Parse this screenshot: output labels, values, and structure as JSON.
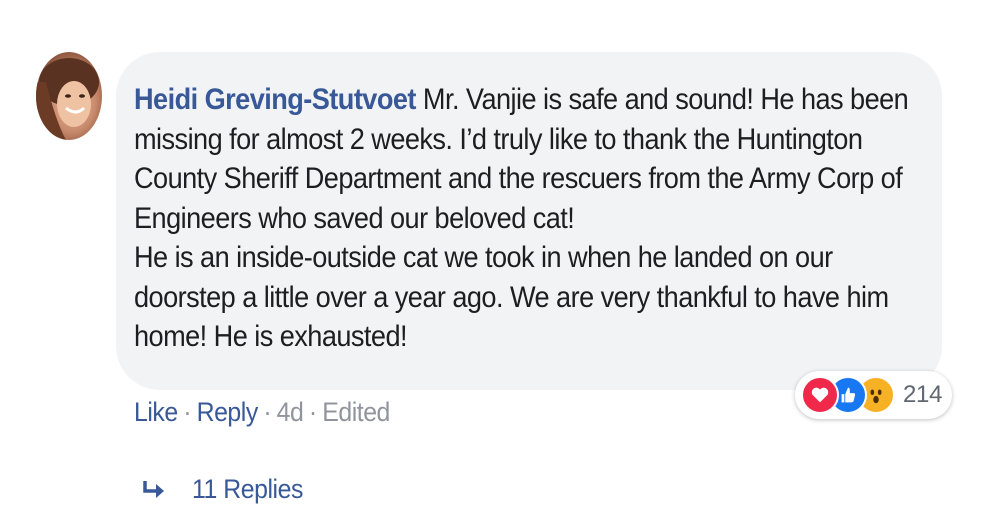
{
  "comment": {
    "author": "Heidi Greving-Stutvoet",
    "first_line_text": " Mr. Vanjie is safe and sound! He has been missing for almost 2 weeks. I’d truly like to thank the Huntington County Sheriff Department and the rescuers from the Army Corp of Engineers who saved our beloved cat!",
    "second_paragraph": "He is an inside-outside cat we took in when he landed on our doorstep a little over a year ago. We are very thankful to have him home! He is exhausted!"
  },
  "reactions": {
    "icons": [
      "love-icon",
      "like-icon",
      "wow-icon"
    ],
    "count": "214"
  },
  "actions": {
    "like_label": "Like",
    "reply_label": "Reply",
    "time": "4d",
    "edited_label": "Edited",
    "separator": "·"
  },
  "replies": {
    "label": "11 Replies",
    "icon": "reply-arrow-icon"
  },
  "colors": {
    "link": "#385898",
    "bubble": "#f2f3f5",
    "text": "#1c1e21",
    "muted": "#90949c",
    "love": "#f0284a",
    "like": "#1877f2",
    "wow": "#f7b125"
  }
}
